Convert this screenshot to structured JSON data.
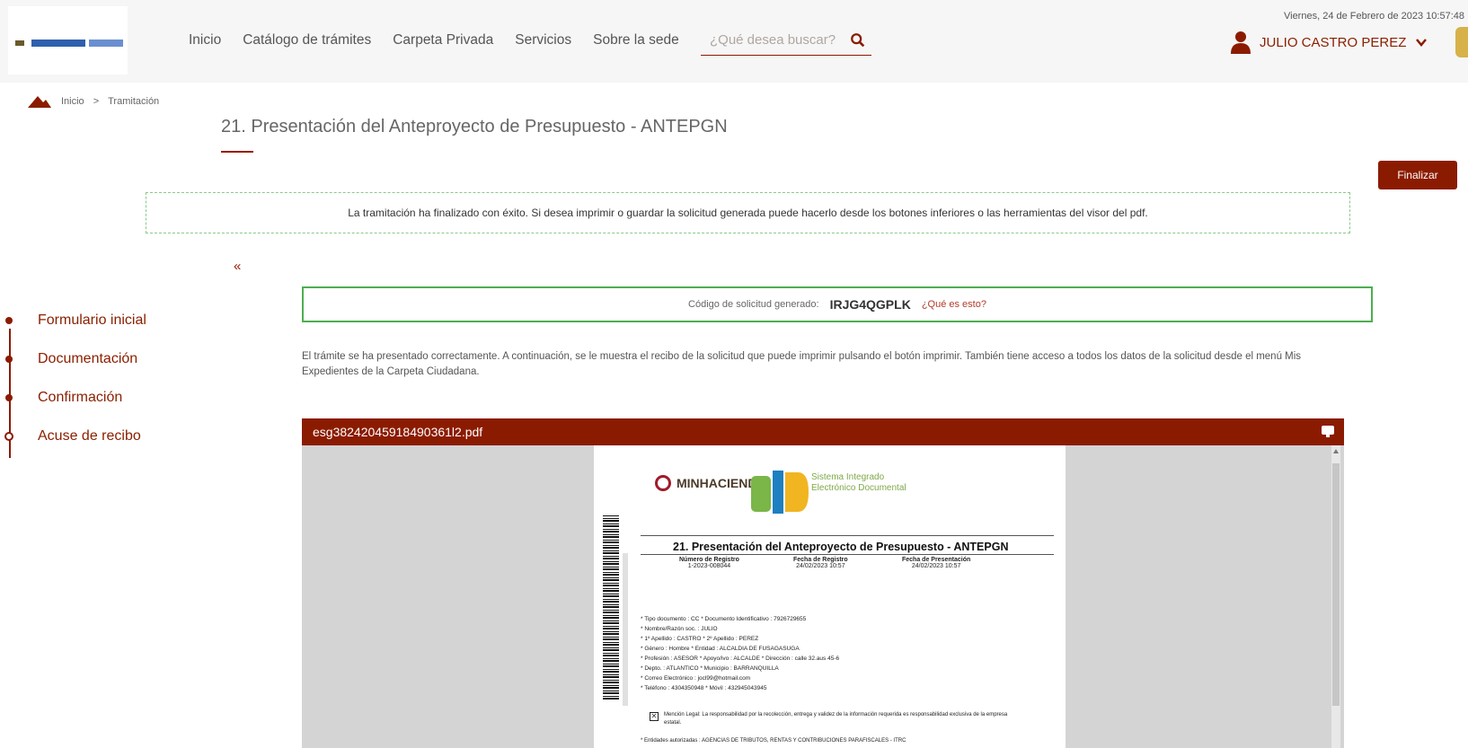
{
  "header": {
    "nav": [
      "Inicio",
      "Catálogo de trámites",
      "Carpeta Privada",
      "Servicios",
      "Sobre la sede"
    ],
    "search_placeholder": "¿Qué desea buscar?",
    "datetime": "Viernes, 24 de Febrero de 2023 10:57:48",
    "user_name": "JULIO CASTRO PEREZ"
  },
  "breadcrumb": [
    "Inicio",
    ">",
    "Tramitación"
  ],
  "page_title": "21. Presentación del Anteproyecto de Presupuesto - ANTEPGN",
  "finalize_label": "Finalizar",
  "notice": "La tramitación ha finalizado con éxito. Si desea imprimir o guardar la solicitud generada puede hacerlo desde los botones inferiores o las herramientas del visor del pdf.",
  "collapse_label": "«",
  "code": {
    "label": "Código de solicitud generado:",
    "value": "IRJG4QGPLK",
    "help": "¿Qué es esto?"
  },
  "steps": [
    "Formulario inicial",
    "Documentación",
    "Confirmación",
    "Acuse de recibo"
  ],
  "description": "El trámite se ha presentado correctamente. A continuación, se le muestra el recibo de la solicitud que puede imprimir pulsando el botón imprimir. También tiene acceso a todos los datos de la solicitud desde el menú Mis Expedientes de la Carpeta Ciudadana.",
  "viewer": {
    "filename": "esg38242045918490361l2.pdf",
    "doc": {
      "ministry": "MINHACIENDA",
      "system_line1": "Sistema Integrado",
      "system_line2": "Electrónico Documental",
      "title": "21. Presentación del Anteproyecto de Presupuesto - ANTEPGN",
      "meta": [
        {
          "label": "Número de Registro",
          "value": "1-2023-008044"
        },
        {
          "label": "Fecha de Registro",
          "value": "24/02/2023 10:57"
        },
        {
          "label": "Fecha de Presentación",
          "value": "24/02/2023 10:57"
        }
      ],
      "fields": [
        "* Tipo documento : CC   * Documento Identificativo : 7926729655",
        "* Nombre/Razón soc. : JULIO",
        "* 1º Apellido : CASTRO   * 2º Apellido : PEREZ",
        "* Género : Hombre   * Entidad : ALCALDIA DE FUSAGASUGA",
        "* Profesión : ASESOR   * Apoyo/ivo : ALCALDE   * Dirección : calle 32.aus 45-6",
        "* Depto. : ATLANTICO   * Municipio : BARRANQUILLA",
        "* Correo Electrónico : jocl99@hotmail.com",
        "* Teléfono : 4304350948   * Móvil : 432945043945"
      ],
      "legal": "Mención Legal: La responsabilidad por la recolección, entrega y validez de la información requerida es responsabilidad exclusiva de la empresa estatal.",
      "entities": "* Entidades autorizadas :  AGENCIAS DE TRIBUTOS, RENTAS Y CONTRIBUCIONES PARAFISCALES - ITRC"
    }
  },
  "colors": {
    "brand": "#8b1b00",
    "success": "#4caf50",
    "notice_border": "#8ac98a"
  },
  "icons": [
    "logo",
    "search-icon",
    "user-icon",
    "chevron-down-icon",
    "house-icon",
    "monitor-icon"
  ]
}
